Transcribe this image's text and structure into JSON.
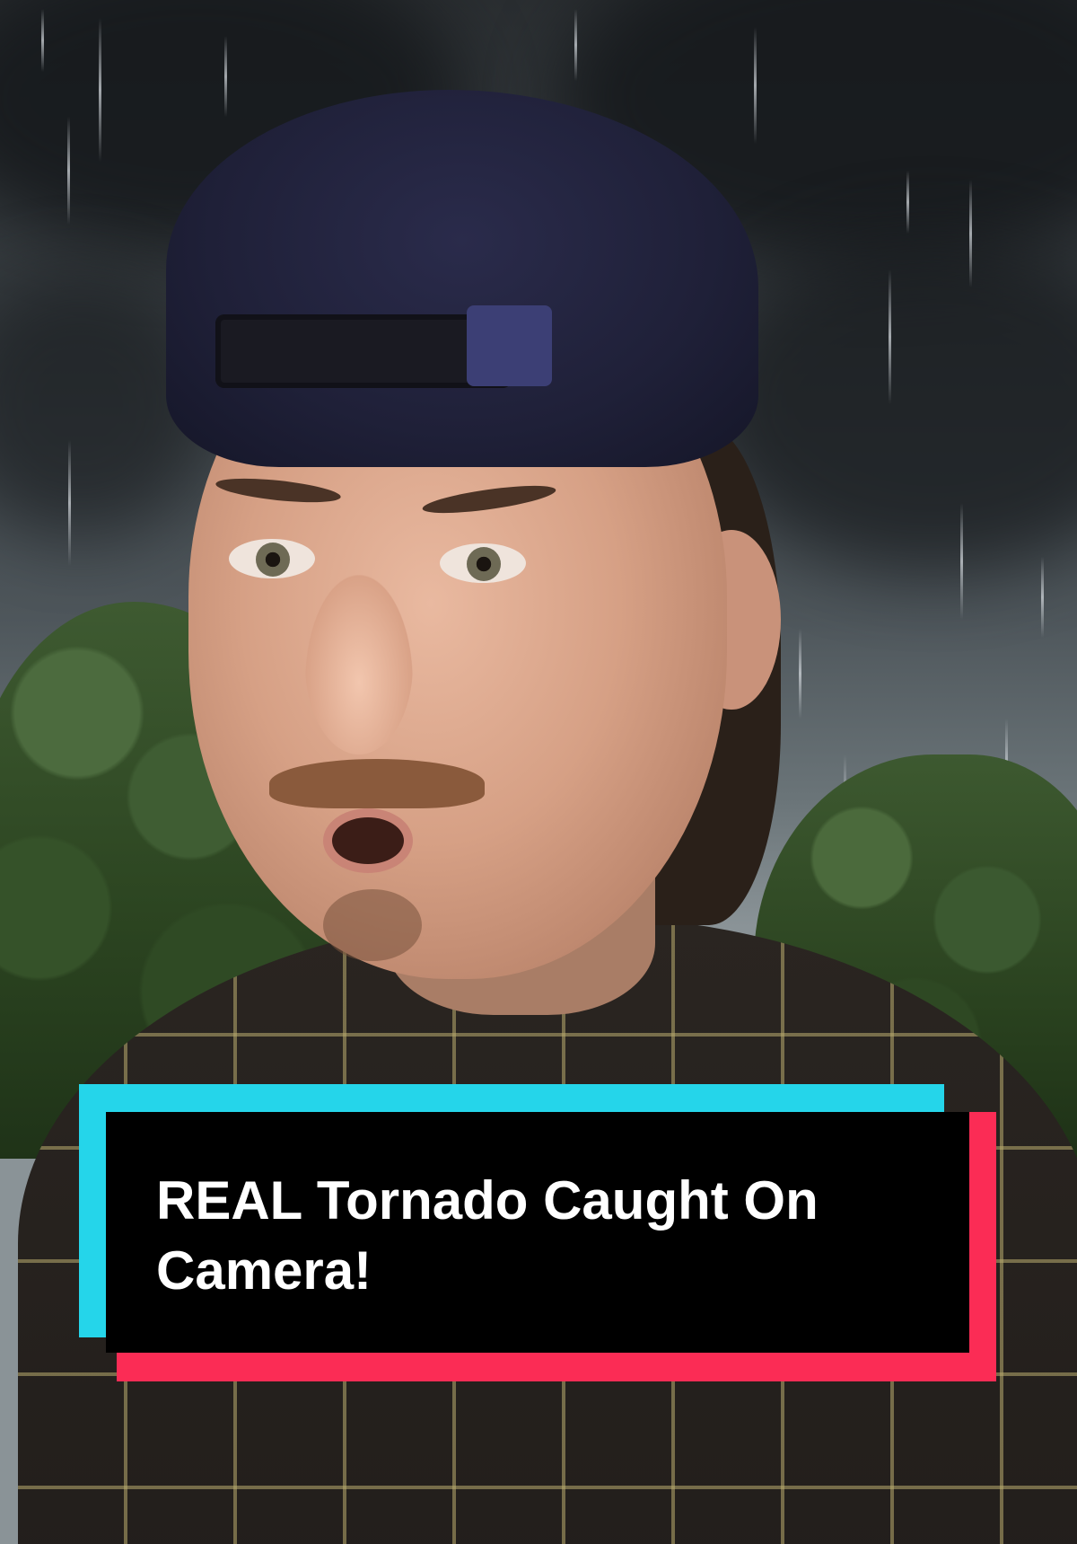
{
  "video": {
    "caption": "REAL Tornado Caught On Camera!"
  },
  "colors": {
    "caption_background": "#000000",
    "caption_text": "#ffffff",
    "accent_cyan": "#25d5ea",
    "accent_red": "#fb2c55"
  }
}
